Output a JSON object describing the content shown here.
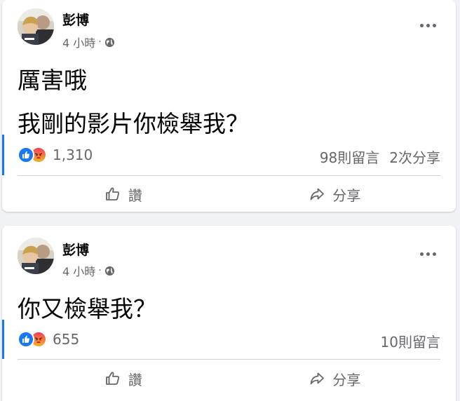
{
  "colors": {
    "background": "#f0f2f5",
    "card": "#ffffff",
    "accent": "#1877f2",
    "secondary_text": "#65676b"
  },
  "posts": [
    {
      "author": "彭博",
      "time": "4 小時",
      "separator": "·",
      "privacy_icon": "globe-icon",
      "content": [
        "厲害哦",
        "我剛的影片你檢舉我？"
      ],
      "reactions": [
        "like",
        "angry"
      ],
      "reaction_count": "1,310",
      "comments": "98則留言",
      "shares": "2次分享",
      "actions": {
        "like": "讚",
        "share": "分享"
      }
    },
    {
      "author": "彭博",
      "time": "4 小時",
      "separator": "·",
      "privacy_icon": "globe-icon",
      "content": [
        "你又檢舉我？"
      ],
      "reactions": [
        "like",
        "angry"
      ],
      "reaction_count": "655",
      "comments": "10則留言",
      "actions": {
        "like": "讚",
        "share": "分享"
      }
    }
  ]
}
